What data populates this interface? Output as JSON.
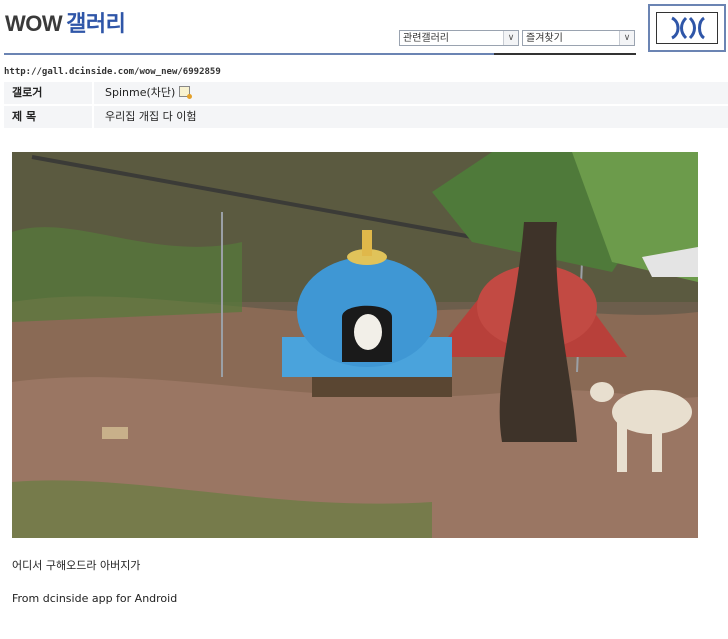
{
  "header": {
    "title_en": "WOW",
    "title_kr": "갤러리",
    "related_select": "관련갤러리",
    "favorites_select": "즐겨찾기",
    "select_arrow": "∨"
  },
  "post": {
    "url": "http://gall.dcinside.com/wow_new/6992859",
    "author_label": "갤로거",
    "author_value": "Spinme(차단)",
    "subject_label": "제  목",
    "subject_value": "우리집 개집 다 이험",
    "body_line1": "어디서 구해오드라 아버지가",
    "body_line2": "From dcinside app for Android"
  },
  "icons": {
    "memo": "memo-icon",
    "logo": "dcinside-logo-icon"
  },
  "colors": {
    "accent": "#2f56a8",
    "rule": "#6b84b3"
  }
}
